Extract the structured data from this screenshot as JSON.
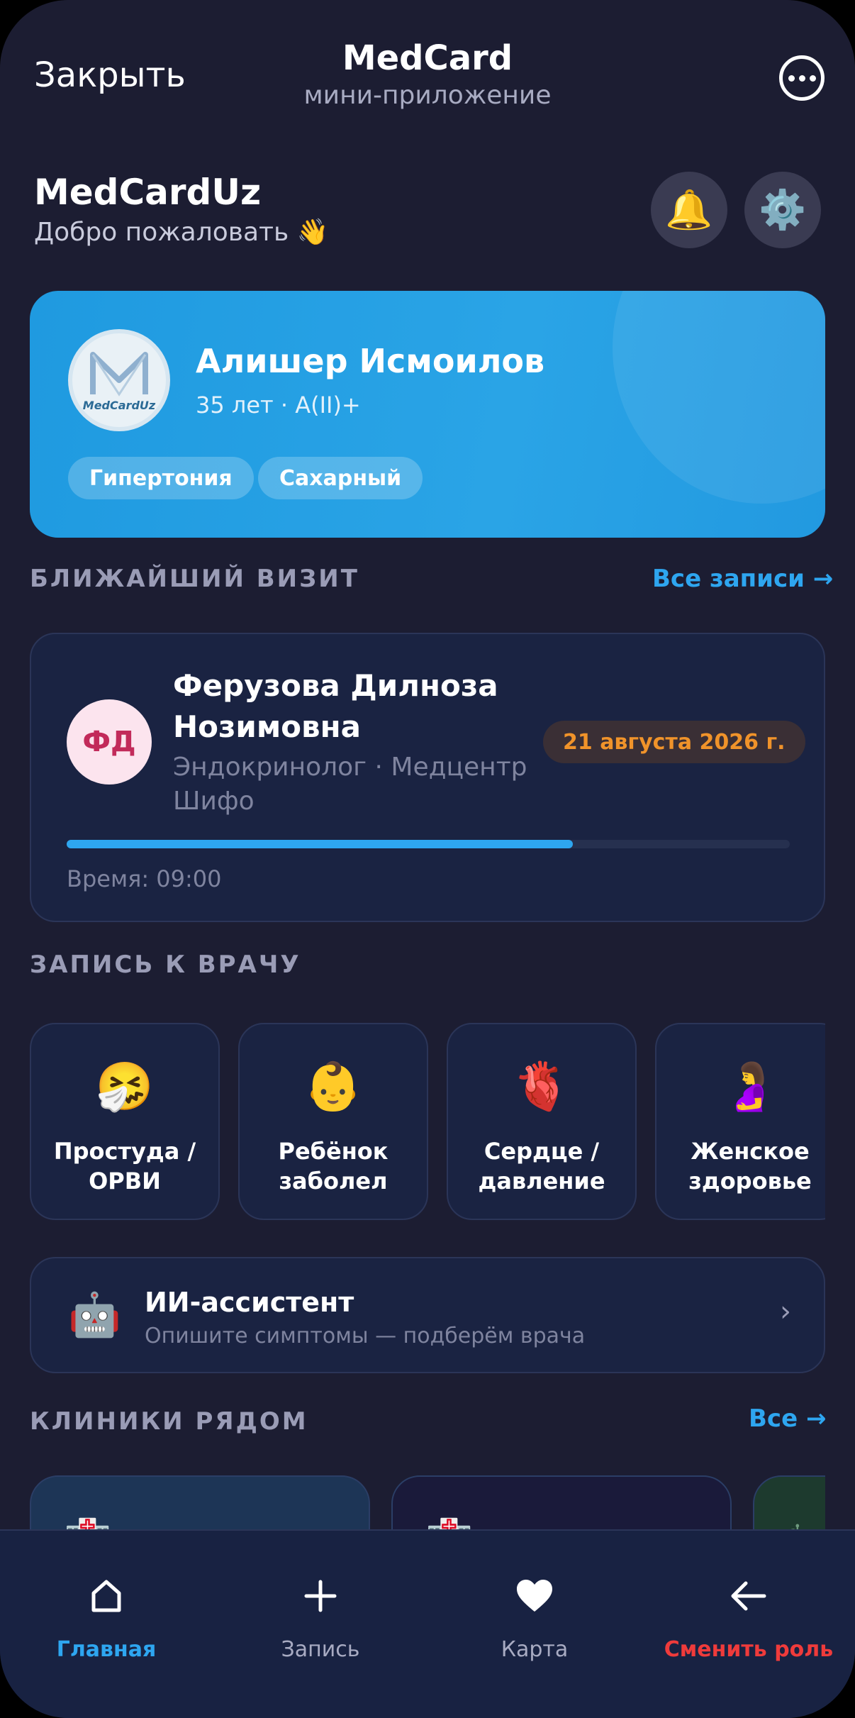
{
  "header": {
    "close_label": "Закрыть",
    "title": "MedCard",
    "subtitle": "мини-приложение"
  },
  "welcome": {
    "brand": "MedCardUz",
    "greeting": "Добро пожаловать 👋"
  },
  "icons": {
    "bell": "🔔",
    "gear": "⚙️"
  },
  "profile": {
    "logo_text": "MedCardUz",
    "name": "Алишер Исмоилов",
    "meta": "35 лет · A(II)+",
    "tags": [
      "Гипертония",
      "Сахарный"
    ]
  },
  "next_visit": {
    "section_title": "БЛИЖАЙШИЙ ВИЗИТ",
    "all_link": "Все записи →",
    "doctor_initials": "ФД",
    "doctor_name": "Ферузова Дилноза Нозимовна",
    "specialty": "Эндокринолог · Медцентр Шифо",
    "date": "21 августа 2026 г.",
    "progress": 0.7,
    "time": "Время: 09:00"
  },
  "booking": {
    "section_title": "ЗАПИСЬ К ВРАЧУ",
    "categories": [
      {
        "emoji": "🤧",
        "label": "Простуда / ОРВИ"
      },
      {
        "emoji": "👶",
        "label": "Ребёнок заболел"
      },
      {
        "emoji": "🫀",
        "label": "Сердце / давление"
      },
      {
        "emoji": "🤰",
        "label": "Женское здоровье"
      }
    ]
  },
  "ai_assistant": {
    "icon": "🤖",
    "title": "ИИ-ассистент",
    "subtitle": "Опишите симптомы — подберём врача",
    "chevron": "›"
  },
  "clinics": {
    "section_title": "КЛИНИКИ РЯДОМ",
    "all_link": "Все →",
    "colors": [
      "#1d3556",
      "#1a1a3a",
      "#1d3a2e"
    ]
  },
  "nav": {
    "items": [
      {
        "icon": "⌂",
        "label": "Главная"
      },
      {
        "icon": "+",
        "label": "Запись"
      },
      {
        "icon": "♥",
        "label": "Карта"
      },
      {
        "icon": "←",
        "label": "Сменить роль"
      }
    ]
  },
  "colors": {
    "background": "#1c1d32",
    "accent": "#2ea6f0",
    "card": "#1a2342",
    "date_badge": "#f0932a",
    "danger": "#ef3b3b"
  }
}
